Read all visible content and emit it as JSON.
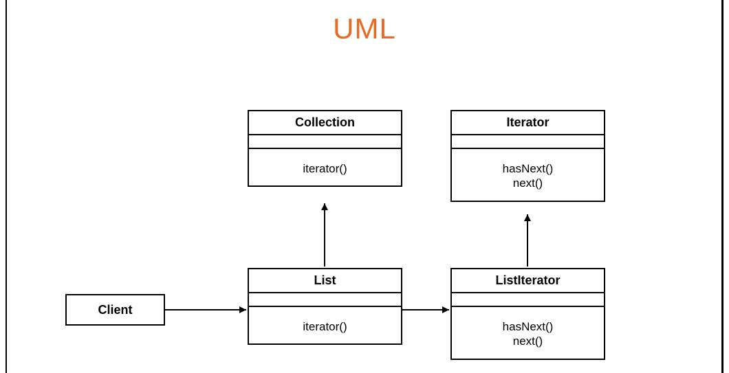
{
  "title": "UML",
  "title_color": "#e96a24",
  "boxes": {
    "collection": {
      "name": "Collection",
      "ops": [
        "iterator()"
      ]
    },
    "iterator": {
      "name": "Iterator",
      "ops": [
        "hasNext()",
        "next()"
      ]
    },
    "list": {
      "name": "List",
      "ops": [
        "iterator()"
      ]
    },
    "listIterator": {
      "name": "ListIterator",
      "ops": [
        "hasNext()",
        "next()"
      ]
    },
    "client": {
      "name": "Client"
    }
  }
}
